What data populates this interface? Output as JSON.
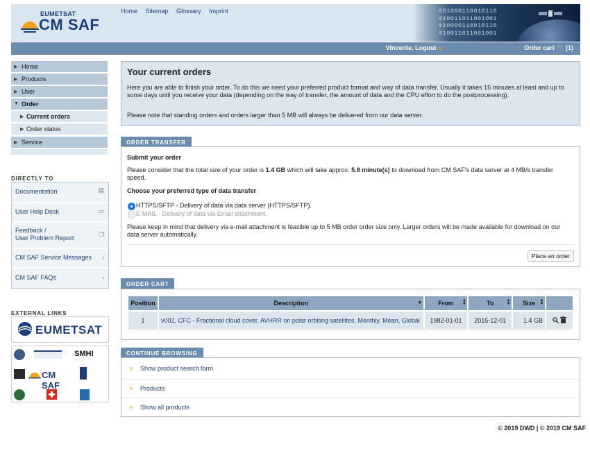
{
  "header": {
    "logo_small": "EUMETSAT",
    "logo_big": "CM SAF",
    "topnav": [
      "Home",
      "Sitemap",
      "Glossary",
      "Imprint"
    ],
    "binary_lines": [
      "001000110010110",
      "010011011001001",
      "010000110010110",
      "010011011001001"
    ]
  },
  "userbar": {
    "user": "Vincente, Logout",
    "cart_label": "Order cart",
    "cart_count": "(1)",
    "arrow": "»"
  },
  "sidebar": {
    "items": [
      {
        "label": "Home"
      },
      {
        "label": "Products"
      },
      {
        "label": "User"
      },
      {
        "label": "Order"
      },
      {
        "label": "Current orders"
      },
      {
        "label": "Order status"
      },
      {
        "label": "Service"
      }
    ],
    "directly_to_title": "DIRECTLY TO",
    "direct_links": [
      {
        "label": "Documentation",
        "icon": "document-icon"
      },
      {
        "label": "User Help Desk",
        "icon": "helpdesk-icon"
      },
      {
        "label": "Feedback /",
        "label2": "User Problem Report",
        "icon": "feedback-icon"
      },
      {
        "label": "CM SAF Service Messages",
        "icon": "chevron-right-icon"
      },
      {
        "label": "CM SAF FAQs",
        "icon": "chevron-right-icon"
      }
    ],
    "external_links_title": "EXTERNAL LINKS",
    "eumetsat_logo": "EUMETSAT",
    "partner_logo_cmsaf": "CM SAF",
    "partner_smhi": "SMHI"
  },
  "intro": {
    "title": "Your current orders",
    "p1": "Here you are able to finish your order. To do this we need your preferred product format and way of data transfer. Usually it takes 15 minutes at least and up to some days until you receive your data (depending on the way of transfer, the amount of data and the CPU effort to do the postprocessing).",
    "p2": "Please note that standing orders and orders larger than 5 MB will always be delivered from our data server."
  },
  "transfer": {
    "tab": "ORDER TRANSFER",
    "submit_heading": "Submit your order",
    "size_text_a": "Please consider that the total size of your order is ",
    "size_value": "1.4 GB",
    "size_text_b": " which will take approx. ",
    "time_value": "5.8 minute(s)",
    "size_text_c": " to download from CM SAF's data server at 4 MB/s transfer speed.",
    "choose_heading": "Choose your preferred type of data transfer",
    "option1": "HTTPS/SFTP - Delivery of data via data server (HTTPS/SFTP).",
    "option2": "E-MAIL - Delivery of data via Email attachment.",
    "note": "Please keep in mind that delivery via e-mail attachment is feasible up to 5 MB order order size only. Larger orders will be made available for download on our data server automatically.",
    "place_order": "Place an order"
  },
  "cart": {
    "tab": "ORDER CART",
    "columns": [
      "Position",
      "Description",
      "From",
      "To",
      "Size"
    ],
    "rows": [
      {
        "position": "1",
        "description": "v002, CFC - Fractional cloud cover, AVHRR on polar orbiting satellites, Monthly, Mean, Global",
        "from": "1982-01-01",
        "to": "2015-12-01",
        "size": "1.4 GB"
      }
    ]
  },
  "browse": {
    "tab": "CONTINUE BROWSING",
    "links": [
      "Show product search form",
      "Products",
      "Show all products"
    ]
  },
  "footer": "© 2019 DWD | © 2019 CM SAF",
  "colors": {
    "accent": "#6b8cae",
    "brand": "#1e3f79",
    "orange": "#f0a020"
  }
}
